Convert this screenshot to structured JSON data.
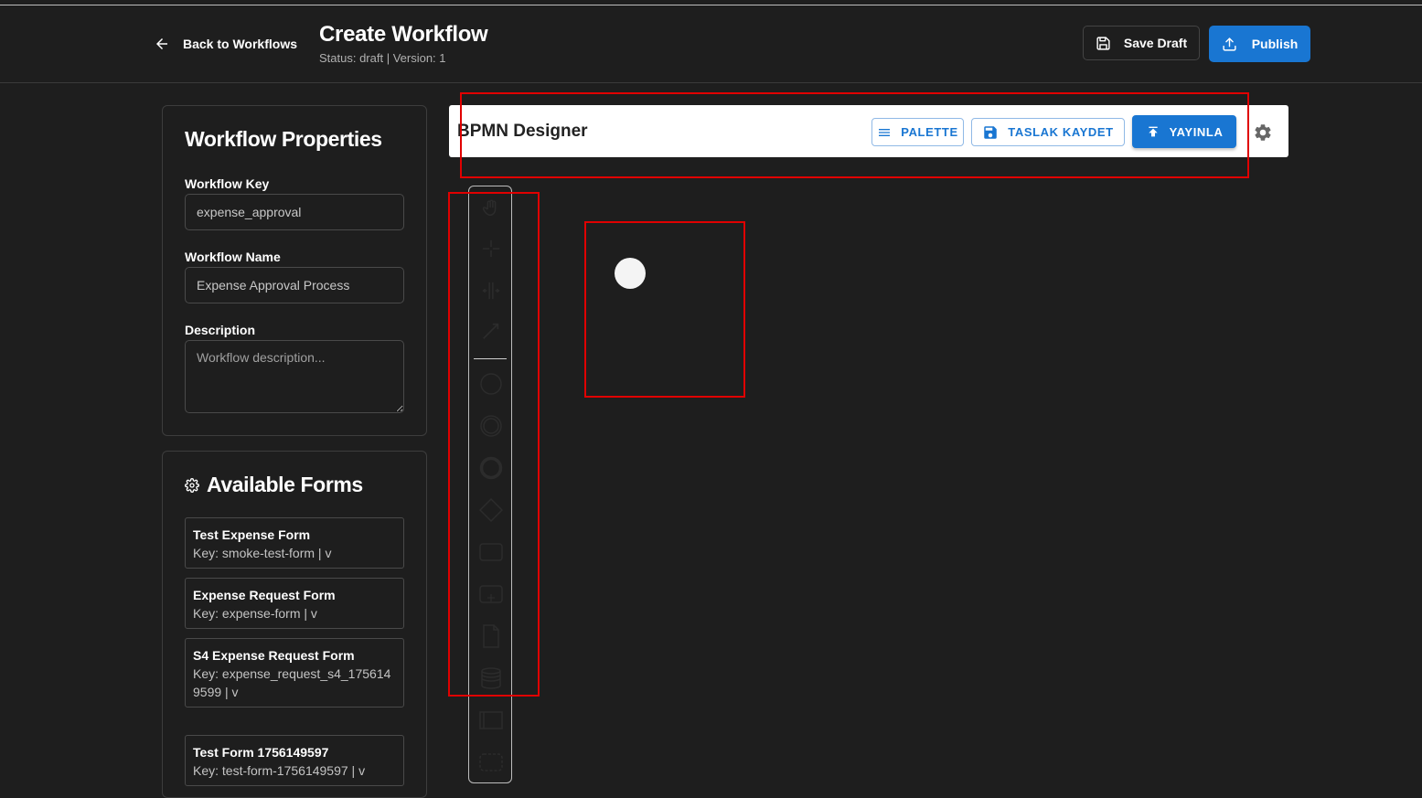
{
  "header": {
    "back_label": "Back to Workflows",
    "title": "Create Workflow",
    "status": "Status: draft | Version: 1",
    "save_draft_label": "Save Draft",
    "publish_label": "Publish"
  },
  "properties": {
    "title": "Workflow Properties",
    "key_label": "Workflow Key",
    "key_value": "expense_approval",
    "name_label": "Workflow Name",
    "name_value": "Expense Approval Process",
    "description_label": "Description",
    "description_placeholder": "Workflow description..."
  },
  "forms": {
    "title": "Available Forms",
    "items": [
      {
        "name": "Test Expense Form",
        "key": "Key: smoke-test-form | v"
      },
      {
        "name": "Expense Request Form",
        "key": "Key: expense-form | v"
      },
      {
        "name": "S4 Expense Request Form",
        "key": "Key: expense_request_s4_1756149599 | v"
      },
      {
        "name": "Test Form 1756149597",
        "key": "Key: test-form-1756149597 | v"
      }
    ]
  },
  "designer": {
    "title": "BPMN Designer",
    "palette_label": "PALETTE",
    "draft_label": "TASLAK KAYDET",
    "publish_label": "YAYINLA"
  },
  "palette_tools": [
    "hand-tool-icon",
    "lasso-tool-icon",
    "space-tool-icon",
    "connect-tool-icon",
    "start-event-icon",
    "intermediate-event-icon",
    "end-event-icon",
    "gateway-icon",
    "task-icon",
    "subprocess-icon",
    "data-object-icon",
    "data-store-icon",
    "pool-icon",
    "group-icon"
  ],
  "colors": {
    "background": "#1e1e1e",
    "primary": "#1976d2",
    "highlight": "#e00000"
  }
}
